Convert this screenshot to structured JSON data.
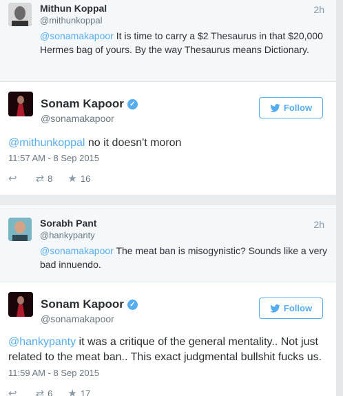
{
  "tweets": [
    {
      "reply_name": "Mithun Koppal",
      "reply_handle": "@mithunkoppal",
      "reply_time": "2h",
      "reply_mention": "@sonamakapoor",
      "reply_text_line1": " It is time to carry a $2 Thesaurus in that",
      "reply_text_rest": "$20,000 Hermes bag of yours. By the way Thesaurus means Dictionary.",
      "main_name": "Sonam Kapoor",
      "main_handle": "@sonamakapoor",
      "follow_label": "Follow",
      "main_mention": "@mithunkoppal",
      "main_text": " no it doesn't moron",
      "main_timestamp": "11:57 AM - 8 Sep 2015",
      "retweets": "8",
      "favorites": "16"
    },
    {
      "reply_name": "Sorabh Pant",
      "reply_handle": "@hankypanty",
      "reply_time": "2h",
      "reply_mention": "@sonamakapoor",
      "reply_text_line1": " The meat ban is misogynistic? Sounds like a",
      "reply_text_rest": "very bad innuendo.",
      "main_name": "Sonam Kapoor",
      "main_handle": "@sonamakapoor",
      "follow_label": "Follow",
      "main_mention": "@hankypanty",
      "main_text": " it was a critique of the general mentality.. Not just related to the meat ban.. This exact judgmental bullshit fucks us.",
      "main_timestamp": "11:59 AM - 8 Sep 2015",
      "retweets": "6",
      "favorites": "17"
    }
  ],
  "icons": {
    "reply": "reply-icon",
    "retweet": "retweet-icon",
    "favorite": "star-icon",
    "verified": "verified-badge-icon",
    "bird": "twitter-bird-icon"
  },
  "colors": {
    "link": "#55acee",
    "reply_bg": "#f5f8fa",
    "muted": "#66757f"
  }
}
